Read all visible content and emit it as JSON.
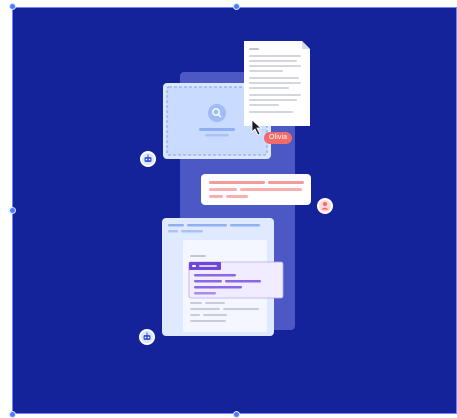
{
  "canvas": {
    "background_color": "#15239a",
    "handle_color": "#4f7bff"
  },
  "illustration": {
    "cursor_label": "Olivia",
    "cursor_label_color": "#f26b6b",
    "icons": [
      "search-icon",
      "robot-icon",
      "user-icon",
      "robot-icon",
      "cursor-icon"
    ]
  }
}
